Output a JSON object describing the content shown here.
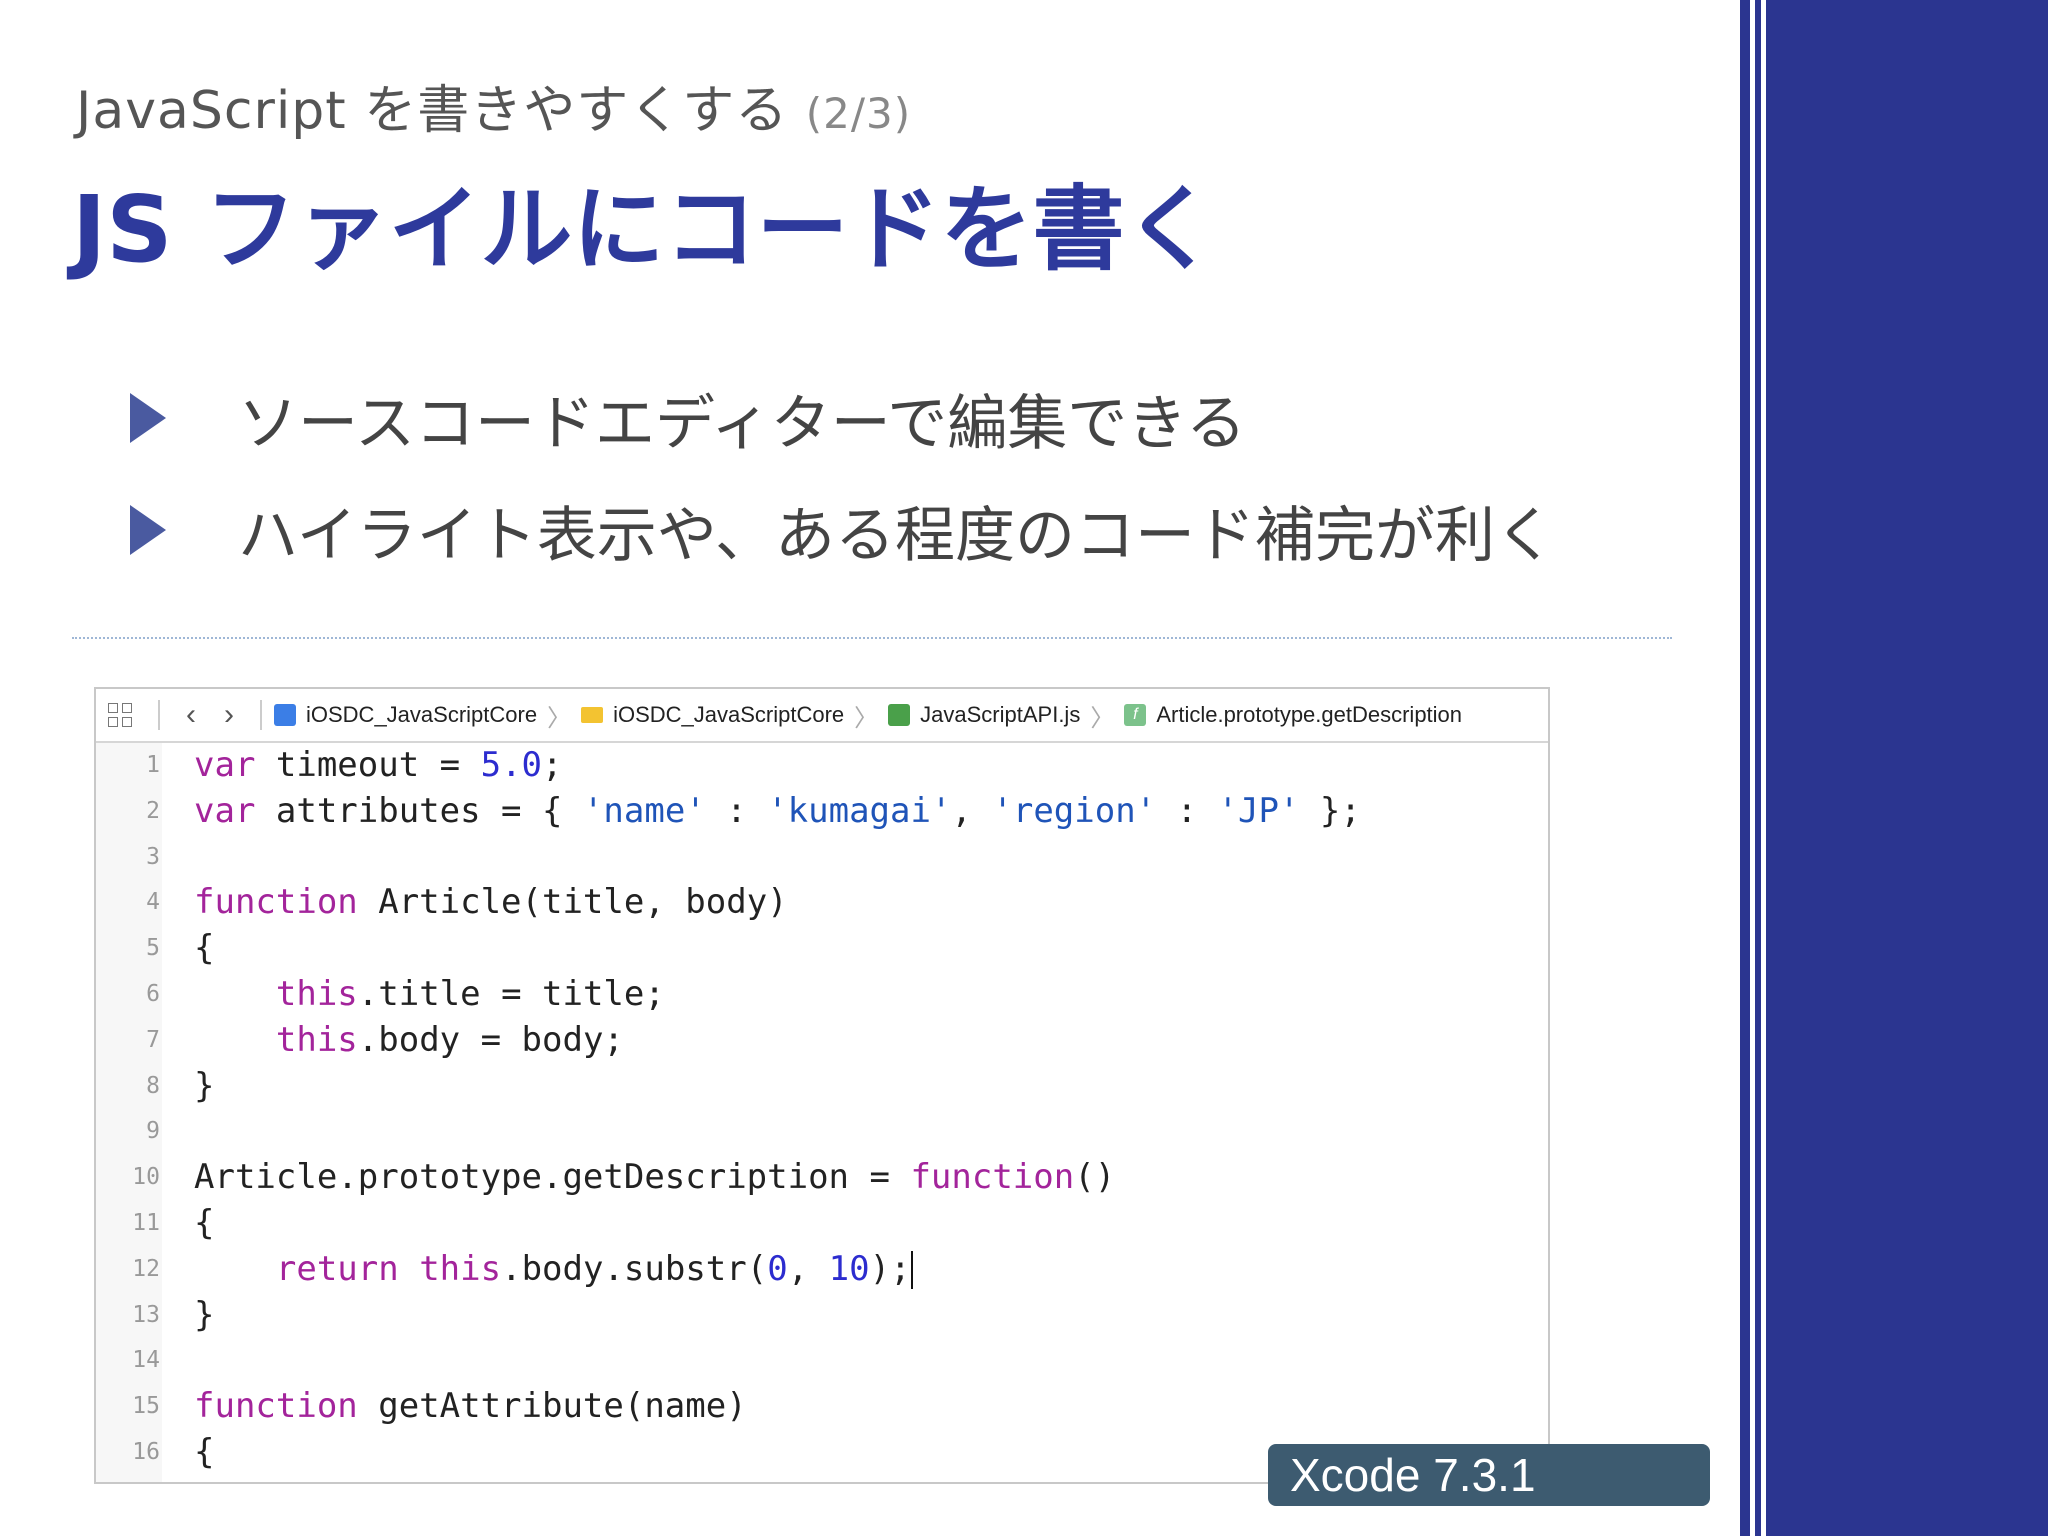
{
  "slide": {
    "subtitle": "JavaScript を書きやすくする",
    "subtitle_page": "(2/3)",
    "title": "JS ファイルにコードを書く",
    "bullets": [
      "ソースコードエディターで編集できる",
      "ハイライト表示や、ある程度のコード補完が利く"
    ],
    "badge": "Xcode 7.3.1",
    "accent_color": "#2e3a9c",
    "band_color": "#2b3590"
  },
  "editor": {
    "breadcrumbs": [
      {
        "label": "iOSDC_JavaScriptCore",
        "icon": "project-icon"
      },
      {
        "label": "iOSDC_JavaScriptCore",
        "icon": "folder-icon"
      },
      {
        "label": "JavaScriptAPI.js",
        "icon": "js-file-icon"
      },
      {
        "label": "Article.prototype.getDescription",
        "icon": "function-icon"
      }
    ],
    "line_numbers": [
      "1",
      "2",
      "3",
      "4",
      "5",
      "6",
      "7",
      "8",
      "9",
      "10",
      "11",
      "12",
      "13",
      "14",
      "15",
      "16"
    ]
  }
}
